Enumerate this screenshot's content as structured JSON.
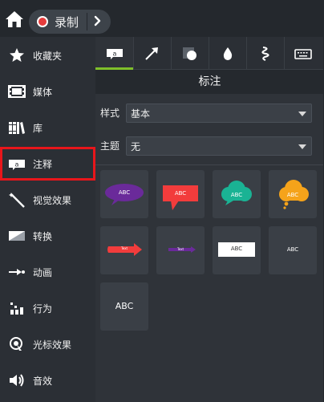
{
  "toolbar": {
    "record_label": "录制"
  },
  "sidebar": {
    "items": [
      {
        "label": "收藏夹",
        "icon": "star-icon"
      },
      {
        "label": "媒体",
        "icon": "film-strip-icon"
      },
      {
        "label": "库",
        "icon": "library-books-icon"
      },
      {
        "label": "注释",
        "icon": "annotation-callout-icon",
        "selected": true
      },
      {
        "label": "视觉效果",
        "icon": "magic-wand-icon"
      },
      {
        "label": "转换",
        "icon": "transition-icon"
      },
      {
        "label": "动画",
        "icon": "animation-arrow-icon"
      },
      {
        "label": "行为",
        "icon": "behavior-icon"
      },
      {
        "label": "光标效果",
        "icon": "cursor-effect-icon"
      },
      {
        "label": "音效",
        "icon": "speaker-icon"
      }
    ]
  },
  "panel": {
    "tabs": [
      "callout-tab-icon",
      "arrow-tab-icon",
      "shape-tab-icon",
      "blur-drop-tab-icon",
      "sketch-motion-tab-icon",
      "keystroke-tab-icon"
    ],
    "title": "标注",
    "style_label": "样式",
    "style_value": "基本",
    "theme_label": "主题",
    "theme_value": "无",
    "accent_color": "#7fbf2a",
    "tiles": [
      {
        "text": "ABC",
        "kind": "purple-bubble",
        "color": "#6a2a9a"
      },
      {
        "text": "ABC",
        "kind": "red-speech",
        "color": "#f23c3c"
      },
      {
        "text": "ABC",
        "kind": "teal-cloud",
        "color": "#1ab394"
      },
      {
        "text": "ABC",
        "kind": "orange-thought",
        "color": "#f5a31a"
      },
      {
        "text": "Text",
        "kind": "red-arrow",
        "color": "#f23c3c"
      },
      {
        "text": "Text",
        "kind": "purple-arrow",
        "color": "#6a2a9a"
      },
      {
        "text": "ABC",
        "kind": "white-box",
        "color": "#ffffff"
      },
      {
        "text": "ABC",
        "kind": "plain-text",
        "color": "#ffffff"
      },
      {
        "text": "ABC",
        "kind": "large-text",
        "color": "#ffffff"
      }
    ]
  }
}
